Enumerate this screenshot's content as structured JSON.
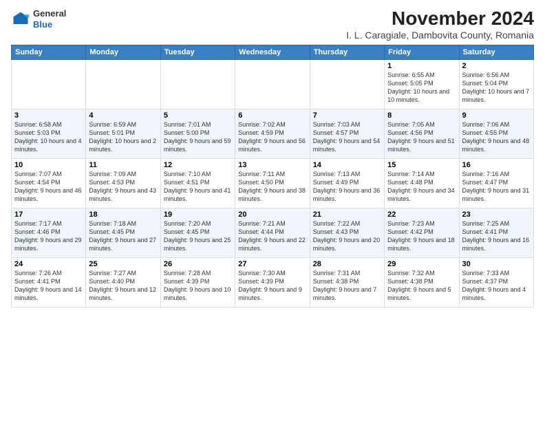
{
  "header": {
    "logo_general": "General",
    "logo_blue": "Blue",
    "title": "November 2024",
    "subtitle": "I. L. Caragiale, Dambovita County, Romania"
  },
  "weekdays": [
    "Sunday",
    "Monday",
    "Tuesday",
    "Wednesday",
    "Thursday",
    "Friday",
    "Saturday"
  ],
  "weeks": [
    [
      {
        "day": "",
        "info": ""
      },
      {
        "day": "",
        "info": ""
      },
      {
        "day": "",
        "info": ""
      },
      {
        "day": "",
        "info": ""
      },
      {
        "day": "",
        "info": ""
      },
      {
        "day": "1",
        "info": "Sunrise: 6:55 AM\nSunset: 5:05 PM\nDaylight: 10 hours and 10 minutes."
      },
      {
        "day": "2",
        "info": "Sunrise: 6:56 AM\nSunset: 5:04 PM\nDaylight: 10 hours and 7 minutes."
      }
    ],
    [
      {
        "day": "3",
        "info": "Sunrise: 6:58 AM\nSunset: 5:03 PM\nDaylight: 10 hours and 4 minutes."
      },
      {
        "day": "4",
        "info": "Sunrise: 6:59 AM\nSunset: 5:01 PM\nDaylight: 10 hours and 2 minutes."
      },
      {
        "day": "5",
        "info": "Sunrise: 7:01 AM\nSunset: 5:00 PM\nDaylight: 9 hours and 59 minutes."
      },
      {
        "day": "6",
        "info": "Sunrise: 7:02 AM\nSunset: 4:59 PM\nDaylight: 9 hours and 56 minutes."
      },
      {
        "day": "7",
        "info": "Sunrise: 7:03 AM\nSunset: 4:57 PM\nDaylight: 9 hours and 54 minutes."
      },
      {
        "day": "8",
        "info": "Sunrise: 7:05 AM\nSunset: 4:56 PM\nDaylight: 9 hours and 51 minutes."
      },
      {
        "day": "9",
        "info": "Sunrise: 7:06 AM\nSunset: 4:55 PM\nDaylight: 9 hours and 48 minutes."
      }
    ],
    [
      {
        "day": "10",
        "info": "Sunrise: 7:07 AM\nSunset: 4:54 PM\nDaylight: 9 hours and 46 minutes."
      },
      {
        "day": "11",
        "info": "Sunrise: 7:09 AM\nSunset: 4:53 PM\nDaylight: 9 hours and 43 minutes."
      },
      {
        "day": "12",
        "info": "Sunrise: 7:10 AM\nSunset: 4:51 PM\nDaylight: 9 hours and 41 minutes."
      },
      {
        "day": "13",
        "info": "Sunrise: 7:11 AM\nSunset: 4:50 PM\nDaylight: 9 hours and 38 minutes."
      },
      {
        "day": "14",
        "info": "Sunrise: 7:13 AM\nSunset: 4:49 PM\nDaylight: 9 hours and 36 minutes."
      },
      {
        "day": "15",
        "info": "Sunrise: 7:14 AM\nSunset: 4:48 PM\nDaylight: 9 hours and 34 minutes."
      },
      {
        "day": "16",
        "info": "Sunrise: 7:16 AM\nSunset: 4:47 PM\nDaylight: 9 hours and 31 minutes."
      }
    ],
    [
      {
        "day": "17",
        "info": "Sunrise: 7:17 AM\nSunset: 4:46 PM\nDaylight: 9 hours and 29 minutes."
      },
      {
        "day": "18",
        "info": "Sunrise: 7:18 AM\nSunset: 4:45 PM\nDaylight: 9 hours and 27 minutes."
      },
      {
        "day": "19",
        "info": "Sunrise: 7:20 AM\nSunset: 4:45 PM\nDaylight: 9 hours and 25 minutes."
      },
      {
        "day": "20",
        "info": "Sunrise: 7:21 AM\nSunset: 4:44 PM\nDaylight: 9 hours and 22 minutes."
      },
      {
        "day": "21",
        "info": "Sunrise: 7:22 AM\nSunset: 4:43 PM\nDaylight: 9 hours and 20 minutes."
      },
      {
        "day": "22",
        "info": "Sunrise: 7:23 AM\nSunset: 4:42 PM\nDaylight: 9 hours and 18 minutes."
      },
      {
        "day": "23",
        "info": "Sunrise: 7:25 AM\nSunset: 4:41 PM\nDaylight: 9 hours and 16 minutes."
      }
    ],
    [
      {
        "day": "24",
        "info": "Sunrise: 7:26 AM\nSunset: 4:41 PM\nDaylight: 9 hours and 14 minutes."
      },
      {
        "day": "25",
        "info": "Sunrise: 7:27 AM\nSunset: 4:40 PM\nDaylight: 9 hours and 12 minutes."
      },
      {
        "day": "26",
        "info": "Sunrise: 7:28 AM\nSunset: 4:39 PM\nDaylight: 9 hours and 10 minutes."
      },
      {
        "day": "27",
        "info": "Sunrise: 7:30 AM\nSunset: 4:39 PM\nDaylight: 9 hours and 9 minutes."
      },
      {
        "day": "28",
        "info": "Sunrise: 7:31 AM\nSunset: 4:38 PM\nDaylight: 9 hours and 7 minutes."
      },
      {
        "day": "29",
        "info": "Sunrise: 7:32 AM\nSunset: 4:38 PM\nDaylight: 9 hours and 5 minutes."
      },
      {
        "day": "30",
        "info": "Sunrise: 7:33 AM\nSunset: 4:37 PM\nDaylight: 9 hours and 4 minutes."
      }
    ]
  ]
}
